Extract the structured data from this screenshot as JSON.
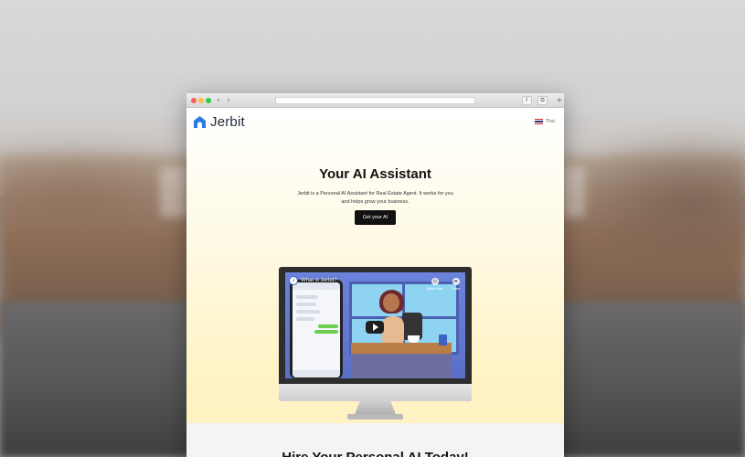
{
  "browser": {
    "nav_back_icon": "chevron-left-icon",
    "nav_forward_icon": "chevron-right-icon",
    "share_icon": "share-icon",
    "tabs_icon": "tabs-icon",
    "new_tab_icon": "plus-icon"
  },
  "site": {
    "brand": "Jerbit",
    "logo_color": "#2a7be4",
    "language_label": "Thai"
  },
  "hero": {
    "title": "Your AI Assistant",
    "description": "Jerbit is a Personal AI Assistant for Real Estate Agent. It works for you and helps grow your business.",
    "cta_label": "Get your AI"
  },
  "video": {
    "title": "What is Jerbit?",
    "watch_later_label": "Watch later",
    "share_label": "Share"
  },
  "section2": {
    "title": "Hire Your Personal AI Today!"
  }
}
